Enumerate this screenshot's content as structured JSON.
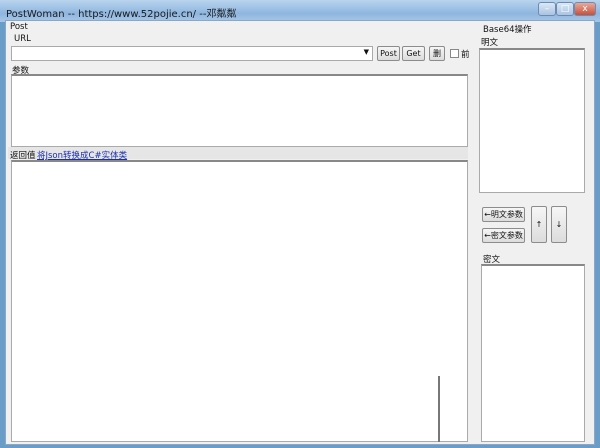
{
  "window": {
    "title": "PostWoman  -- https://www.52pojie.cn/   --邓粼粼",
    "minimize": "–",
    "maximize": "□",
    "close": "x"
  },
  "post_group": {
    "label": "Post",
    "url_label": "URL",
    "url_value": "",
    "post_button": "Post",
    "get_button": "Get",
    "delete_button": "删",
    "checkbox_label": "前",
    "checkbox_checked": false,
    "params_label": "参数",
    "params_value": "",
    "response_label": "返回值",
    "response_link": "将Json转换成C#实体类",
    "response_value": ""
  },
  "base64_group": {
    "label": "Base64操作",
    "plain_label": "明文",
    "plain_value": "",
    "to_plain_button": "←明文参数",
    "to_cipher_button": "←密文参数",
    "up_button": "↑",
    "down_button": "↓",
    "cipher_label": "密文",
    "cipher_value": ""
  }
}
